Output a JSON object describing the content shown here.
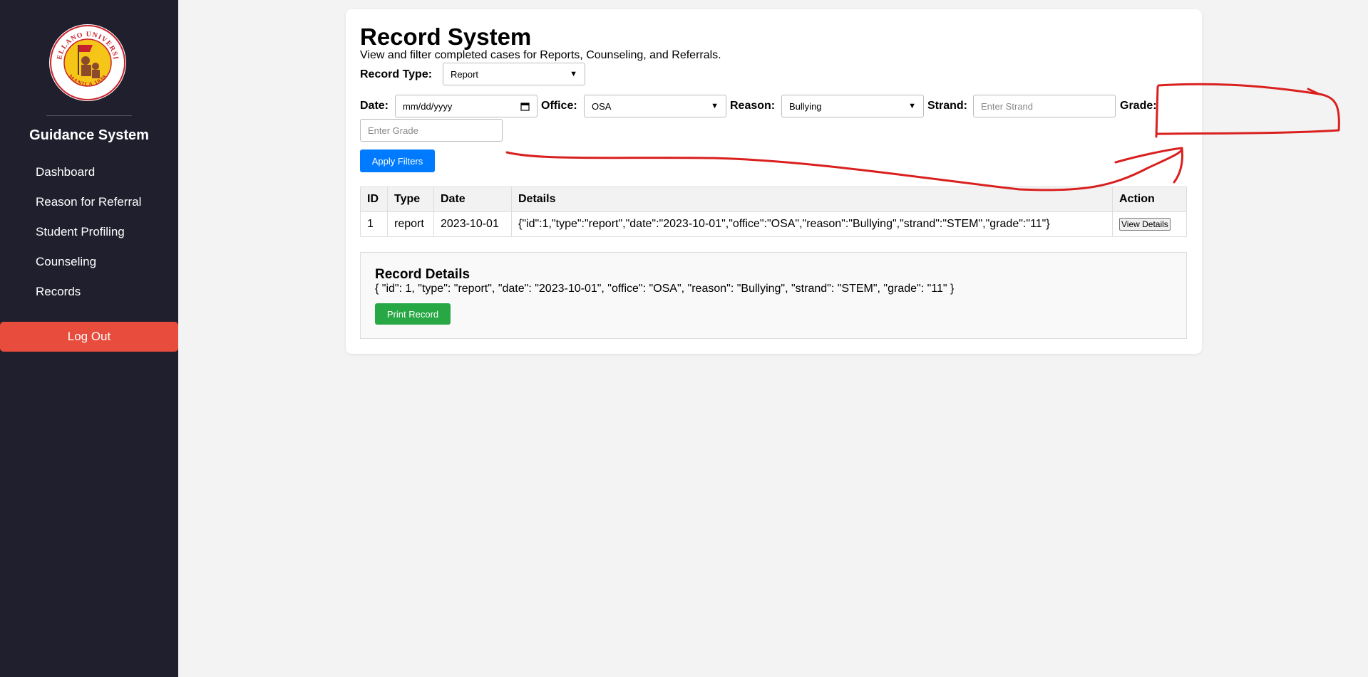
{
  "sidebar": {
    "logo_top_text": "ARELLANO UNIVERSITY",
    "logo_bottom_text": "MANILA 1938",
    "brand": "Guidance System",
    "items": [
      {
        "label": "Dashboard"
      },
      {
        "label": "Reason for Referral"
      },
      {
        "label": "Student Profiling"
      },
      {
        "label": "Counseling"
      },
      {
        "label": "Records"
      }
    ],
    "logout_label": "Log Out"
  },
  "page": {
    "title": "Record System",
    "subtitle": "View and filter completed cases for Reports, Counseling, and Referrals."
  },
  "filters": {
    "record_type_label": "Record Type:",
    "record_type_value": "Report",
    "date_label": "Date:",
    "date_placeholder": "mm/dd/yyyy",
    "office_label": "Office:",
    "office_value": "OSA",
    "reason_label": "Reason:",
    "reason_value": "Bullying",
    "strand_label": "Strand:",
    "strand_placeholder": "Enter Strand",
    "grade_label": "Grade:",
    "grade_placeholder": "Enter Grade",
    "apply_label": "Apply Filters"
  },
  "table": {
    "headers": [
      "ID",
      "Type",
      "Date",
      "Details",
      "Action"
    ],
    "rows": [
      {
        "id": "1",
        "type": "report",
        "date": "2023-10-01",
        "details": "{\"id\":1,\"type\":\"report\",\"date\":\"2023-10-01\",\"office\":\"OSA\",\"reason\":\"Bullying\",\"strand\":\"STEM\",\"grade\":\"11\"}",
        "action_label": "View Details"
      }
    ]
  },
  "details": {
    "title": "Record Details",
    "text": "{ \"id\": 1, \"type\": \"report\", \"date\": \"2023-10-01\", \"office\": \"OSA\", \"reason\": \"Bullying\", \"strand\": \"STEM\", \"grade\": \"11\" }",
    "print_label": "Print Record"
  },
  "colors": {
    "sidebar_bg": "#1f1f2e",
    "logout": "#e74c3c",
    "apply": "#007bff",
    "print": "#28a745",
    "annotation": "#d9201f"
  }
}
